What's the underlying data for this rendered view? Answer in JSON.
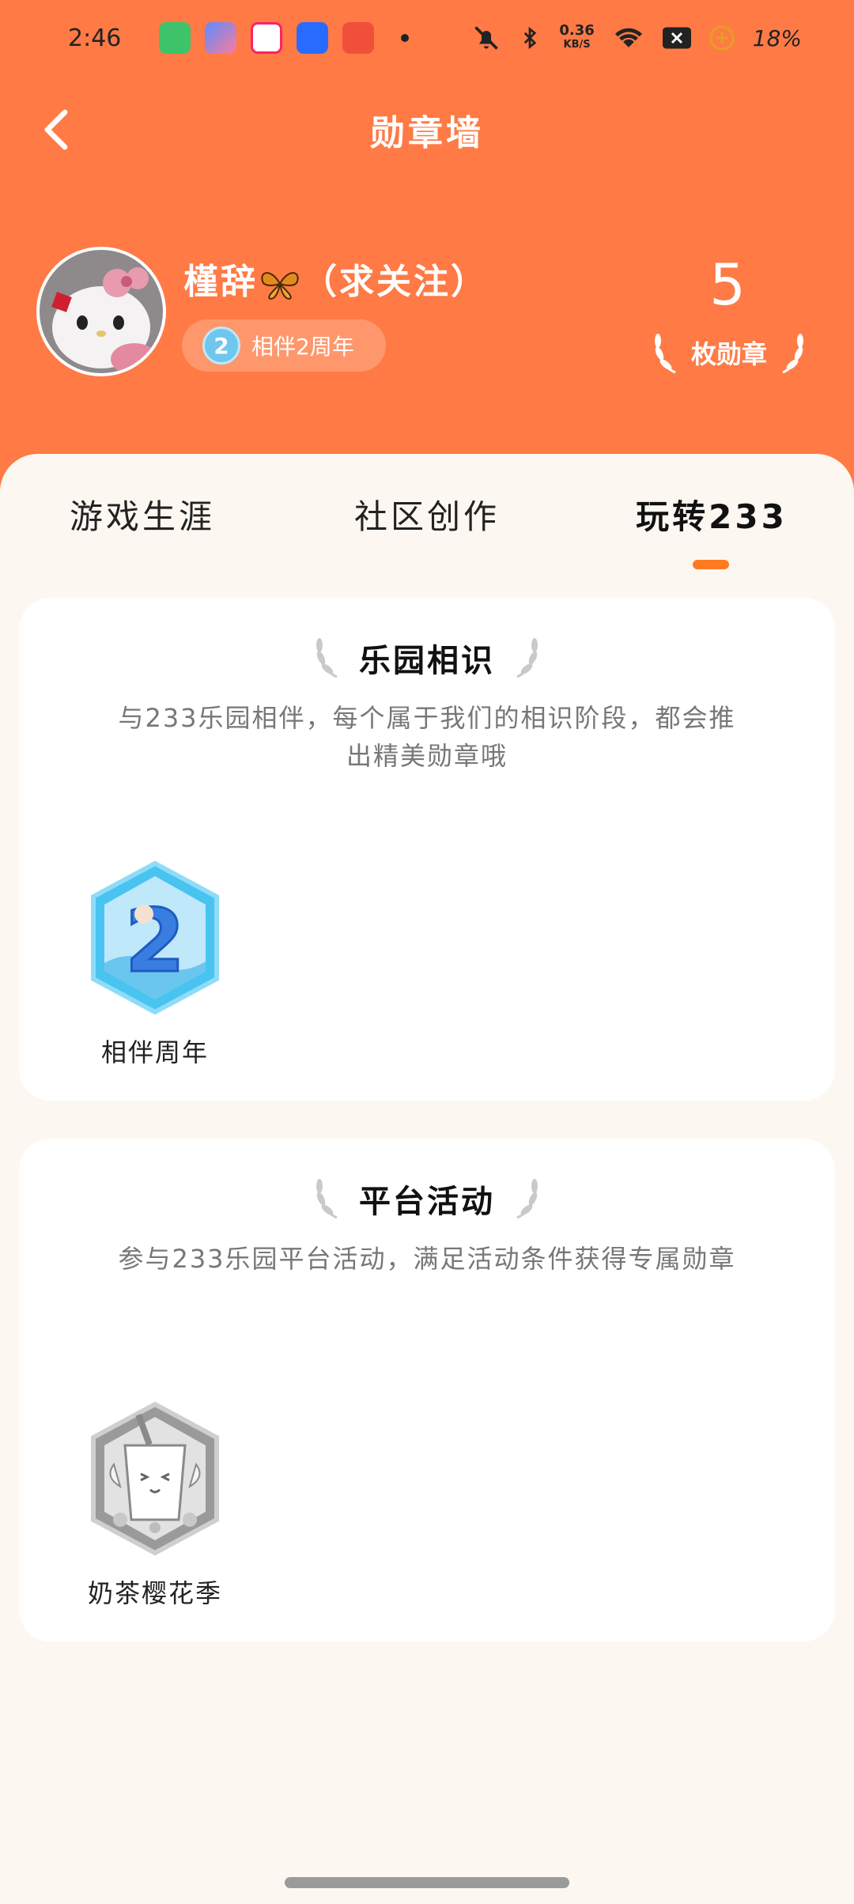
{
  "status_bar": {
    "time": "2:46",
    "net_speed_value": "0.36",
    "net_speed_unit": "KB/S",
    "battery": "18%"
  },
  "nav": {
    "title": "勋章墙"
  },
  "profile": {
    "username": "槿辞",
    "username_suffix": "（求关注）",
    "badge_label": "相伴2周年",
    "badge_number": "2",
    "medal_count": "5",
    "medal_count_label": "枚勋章"
  },
  "tabs": [
    {
      "label": "游戏生涯",
      "active": false
    },
    {
      "label": "社区创作",
      "active": false
    },
    {
      "label": "玩转233",
      "active": true
    }
  ],
  "sections": [
    {
      "title": "乐园相识",
      "description": "与233乐园相伴，每个属于我们的相识阶段，都会推出精美勋章哦",
      "medals": [
        {
          "name": "相伴周年",
          "number": "2"
        }
      ]
    },
    {
      "title": "平台活动",
      "description": "参与233乐园平台活动，满足活动条件获得专属勋章",
      "medals": [
        {
          "name": "奶茶樱花季"
        }
      ]
    }
  ],
  "colors": {
    "brand_orange": "#FF7A45",
    "tab_indicator": "#FF7A20",
    "panel_bg": "#FDF7F1"
  }
}
